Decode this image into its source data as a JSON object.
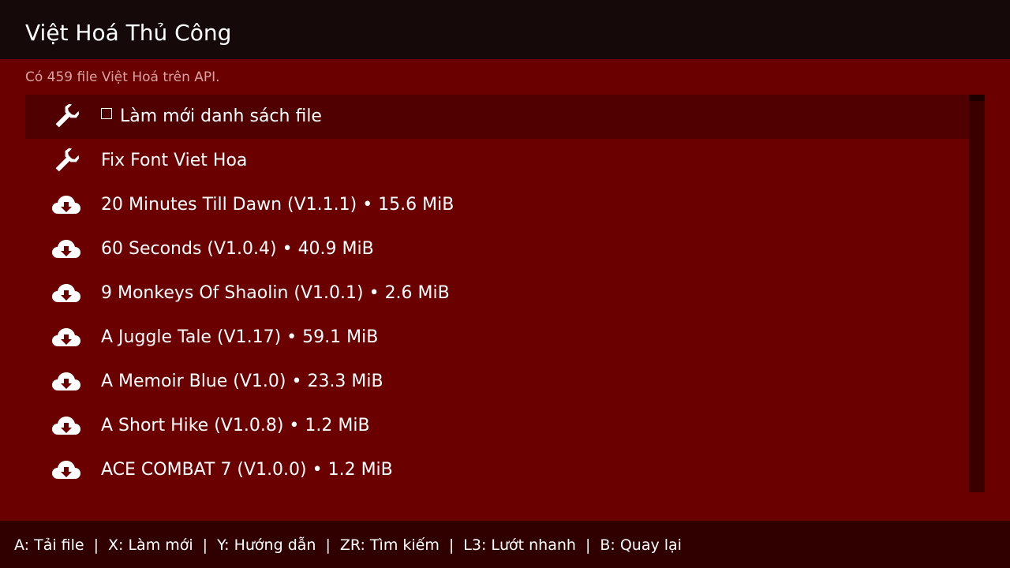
{
  "header": {
    "title": "Việt Hoá Thủ Công"
  },
  "subtitle": "Có 459 file Việt Hoá trên API.",
  "colors": {
    "header_bg": "#150909",
    "body_bg": "#6b0000",
    "selected_row_bg": "#500000",
    "footer_bg": "#300000",
    "scrollbar_track": "#3a0000"
  },
  "list": {
    "items": [
      {
        "icon": "wrench-icon",
        "label": "Làm mới danh sách file",
        "checkbox": true,
        "selected": true
      },
      {
        "icon": "wrench-icon",
        "label": "Fix Font Viet Hoa"
      },
      {
        "icon": "cloud-download-icon",
        "label": "20 Minutes Till Dawn (V1.1.1) • 15.6 MiB"
      },
      {
        "icon": "cloud-download-icon",
        "label": "60 Seconds (V1.0.4) • 40.9 MiB"
      },
      {
        "icon": "cloud-download-icon",
        "label": "9 Monkeys Of Shaolin (V1.0.1) • 2.6 MiB"
      },
      {
        "icon": "cloud-download-icon",
        "label": "A Juggle Tale (V1.17) • 59.1 MiB"
      },
      {
        "icon": "cloud-download-icon",
        "label": "A Memoir Blue (V1.0) • 23.3 MiB"
      },
      {
        "icon": "cloud-download-icon",
        "label": "A Short Hike (V1.0.8) • 1.2 MiB"
      },
      {
        "icon": "cloud-download-icon",
        "label": "ACE COMBAT 7 (V1.0.0) • 1.2 MiB"
      }
    ]
  },
  "footer": {
    "hints": [
      "A: Tải file",
      "X: Làm mới",
      "Y: Hướng dẫn",
      "ZR: Tìm kiếm",
      "L3: Lướt nhanh",
      "B: Quay lại"
    ],
    "separator": "|"
  }
}
